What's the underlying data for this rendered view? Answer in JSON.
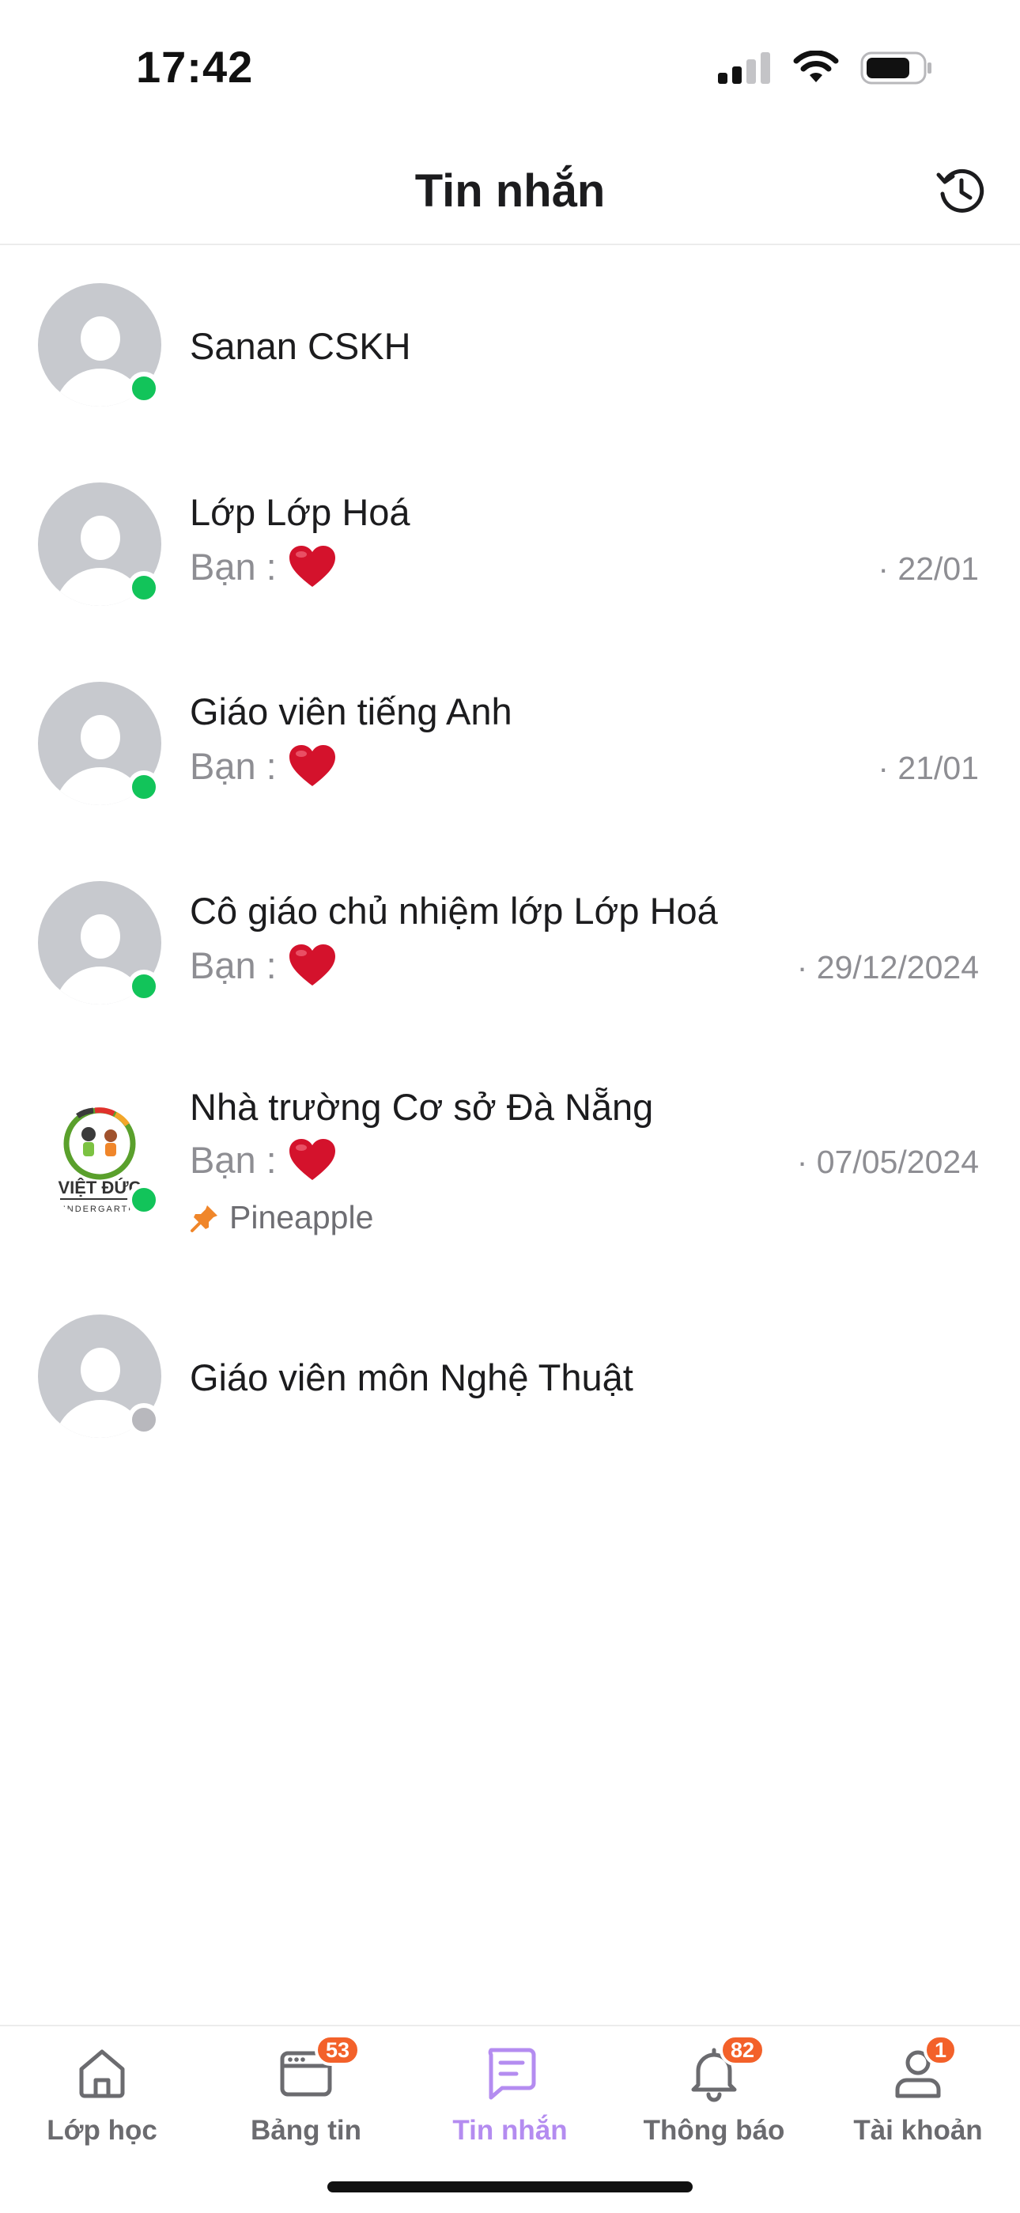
{
  "status_bar": {
    "time": "17:42",
    "signal_icon": "cellular-signal-icon",
    "wifi_icon": "wifi-icon",
    "battery_icon": "battery-icon"
  },
  "header": {
    "title": "Tin nhắn",
    "history_icon": "history-icon"
  },
  "colors": {
    "online": "#12c45a",
    "offline": "#b8b8bd",
    "accent": "#b48cf0",
    "badge": "#f3612a",
    "heart": "#d4122c",
    "pin": "#f0862a"
  },
  "conversations": [
    {
      "name": "Sanan CSKH",
      "preview_sender": "",
      "preview_emoji": "",
      "date": "",
      "online": true,
      "pinned_label": ""
    },
    {
      "name": "Lớp Lớp Hoá",
      "preview_sender": "Bạn :",
      "preview_emoji": "heart-emoji",
      "date": "· 22/01",
      "online": true,
      "pinned_label": ""
    },
    {
      "name": "Giáo viên tiếng Anh",
      "preview_sender": "Bạn :",
      "preview_emoji": "heart-emoji",
      "date": "· 21/01",
      "online": true,
      "pinned_label": ""
    },
    {
      "name": "Cô giáo chủ nhiệm lớp Lớp Hoá",
      "preview_sender": "Bạn :",
      "preview_emoji": "heart-emoji",
      "date": "· 29/12/2024",
      "online": true,
      "pinned_label": ""
    },
    {
      "name": "Nhà trường Cơ sở Đà Nẵng",
      "preview_sender": "Bạn :",
      "preview_emoji": "heart-emoji",
      "date": "· 07/05/2024",
      "online": true,
      "pinned_label": "Pineapple",
      "avatar_logo_text": "VIỆT ĐỨC",
      "avatar_logo_subtext": "KINDERGARTEN"
    },
    {
      "name": "Giáo viên môn Nghệ Thuật",
      "preview_sender": "",
      "preview_emoji": "",
      "date": "",
      "online": false,
      "pinned_label": ""
    }
  ],
  "tabs": [
    {
      "label": "Lớp học",
      "icon": "home-icon",
      "badge": "",
      "active": false
    },
    {
      "label": "Bảng tin",
      "icon": "newsboard-icon",
      "badge": "53",
      "active": false
    },
    {
      "label": "Tin nhắn",
      "icon": "message-icon",
      "badge": "",
      "active": true
    },
    {
      "label": "Thông báo",
      "icon": "bell-icon",
      "badge": "82",
      "active": false
    },
    {
      "label": "Tài khoản",
      "icon": "user-icon",
      "badge": "1",
      "active": false
    }
  ]
}
